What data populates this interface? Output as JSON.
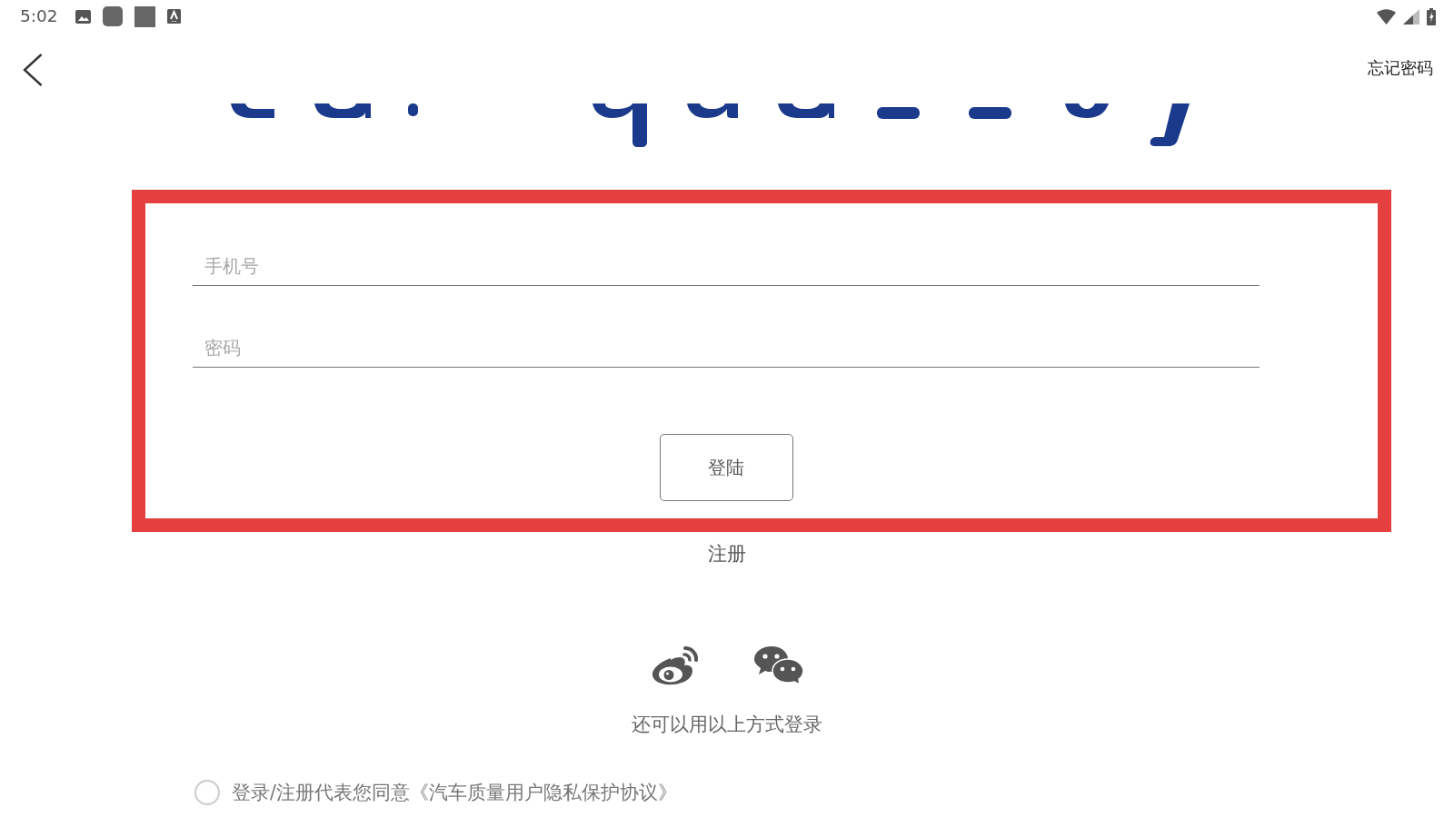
{
  "status_bar": {
    "time": "5:02"
  },
  "header": {
    "forgot_password": "忘记密码"
  },
  "form": {
    "highlighted": true,
    "phone": {
      "placeholder": "手机号"
    },
    "password": {
      "placeholder": "密码"
    },
    "login_button": "登陆"
  },
  "register_link": "注册",
  "social_login": {
    "caption": "还可以用以上方式登录"
  },
  "agreement": {
    "checked": false,
    "text": "登录/注册代表您同意《汽车质量用户隐私保护协议》"
  }
}
